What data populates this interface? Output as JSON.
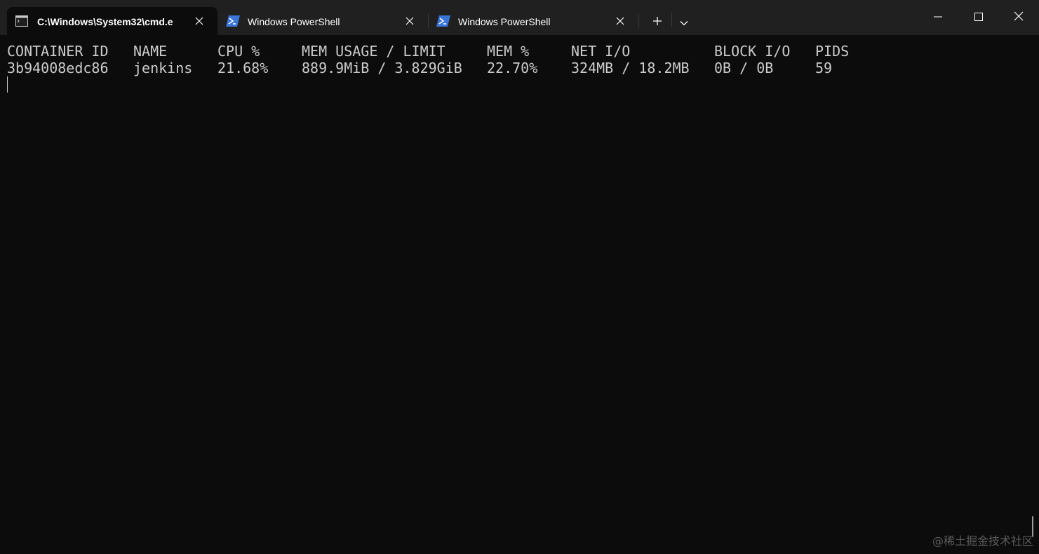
{
  "tabs": [
    {
      "title": "C:\\Windows\\System32\\cmd.e",
      "icon": "cmd-icon",
      "active": true
    },
    {
      "title": "Windows PowerShell",
      "icon": "powershell-icon",
      "active": false
    },
    {
      "title": "Windows PowerShell",
      "icon": "powershell-icon",
      "active": false
    }
  ],
  "toolbar": {
    "new_tab_icon": "plus-icon",
    "dropdown_icon": "chevron-down-icon"
  },
  "window_controls": {
    "minimize_icon": "minimize-icon",
    "maximize_icon": "maximize-icon",
    "close_icon": "close-icon"
  },
  "terminal": {
    "headers": [
      "CONTAINER ID",
      "NAME",
      "CPU %",
      "MEM USAGE / LIMIT",
      "MEM %",
      "NET I/O",
      "BLOCK I/O",
      "PIDS"
    ],
    "rows": [
      [
        "3b94008edc86",
        "jenkins",
        "21.68%",
        "889.9MiB / 3.829GiB",
        "22.70%",
        "324MB / 18.2MB",
        "0B / 0B",
        "59"
      ]
    ]
  },
  "watermark": "@稀土掘金技术社区",
  "colors": {
    "titlebar": "#202020",
    "terminal_bg": "#0c0c0c",
    "terminal_fg": "#cccccc",
    "powershell_icon": "#3a75d8"
  }
}
